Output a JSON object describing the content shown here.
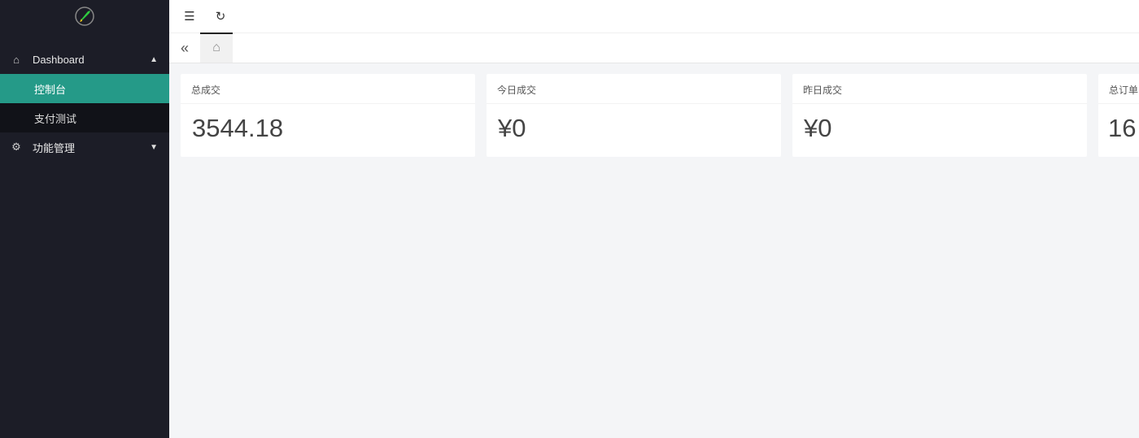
{
  "sidebar": {
    "logo": "rocket-logo",
    "menu": [
      {
        "label": "Dashboard",
        "icon": "home-icon",
        "expanded": true,
        "children": [
          {
            "label": "控制台",
            "active": true
          },
          {
            "label": "支付测试",
            "active": false
          }
        ]
      },
      {
        "label": "功能管理",
        "icon": "gear-icon",
        "expanded": false
      }
    ]
  },
  "topbar": {
    "toggle_icon": "menu-fold-icon",
    "refresh_icon": "refresh-icon"
  },
  "tabs": {
    "back_icon": "double-chevron-left-icon",
    "home_icon": "home-icon"
  },
  "cards": [
    {
      "title": "总成交",
      "value": "3544.18"
    },
    {
      "title": "今日成交",
      "value": "¥0"
    },
    {
      "title": "昨日成交",
      "value": "¥0"
    },
    {
      "title": "总订单",
      "value": "16"
    }
  ],
  "colors": {
    "sidebar": "#1c1d27",
    "active": "#259a88",
    "content_bg": "#f4f5f7"
  }
}
